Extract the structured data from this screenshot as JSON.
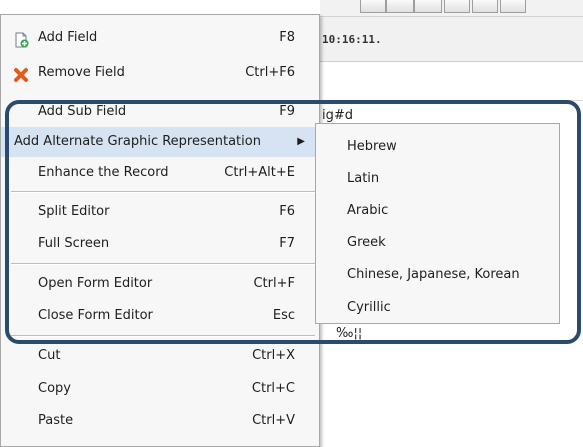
{
  "background": {
    "timestamp": "10:16:11.",
    "field_text": "ig#d",
    "bottom_text": "‰¦¦"
  },
  "menu": {
    "items": [
      {
        "name": "add-field",
        "label": "Add Field",
        "shortcut": "F8",
        "icon": "add-field-icon"
      },
      {
        "name": "remove-field",
        "label": "Remove Field",
        "shortcut": "Ctrl+F6",
        "icon": "remove-field-icon"
      },
      {
        "name": "add-sub-field",
        "label": "Add Sub Field",
        "shortcut": "F9"
      },
      {
        "name": "add-alternate-graphic-representation",
        "label": "Add Alternate Graphic Representation",
        "submenu_arrow": "▶",
        "highlighted": true
      },
      {
        "name": "enhance-the-record",
        "label": "Enhance the Record",
        "shortcut": "Ctrl+Alt+E"
      },
      {
        "name": "split-editor",
        "label": "Split Editor",
        "shortcut": "F6"
      },
      {
        "name": "full-screen",
        "label": "Full Screen",
        "shortcut": "F7"
      },
      {
        "name": "open-form-editor",
        "label": "Open Form Editor",
        "shortcut": "Ctrl+F"
      },
      {
        "name": "close-form-editor",
        "label": "Close Form Editor",
        "shortcut": "Esc"
      },
      {
        "name": "cut",
        "label": "Cut",
        "shortcut": "Ctrl+X"
      },
      {
        "name": "copy",
        "label": "Copy",
        "shortcut": "Ctrl+C"
      },
      {
        "name": "paste",
        "label": "Paste",
        "shortcut": "Ctrl+V"
      }
    ]
  },
  "submenu": {
    "items": [
      "Hebrew",
      "Latin",
      "Arabic",
      "Greek",
      "Chinese, Japanese, Korean",
      "Cyrillic"
    ]
  },
  "colors": {
    "highlight": "#d5e3f2",
    "callout_border": "#2c4a6b",
    "remove_icon": "#e25a1c",
    "add_icon": "#3aa14a"
  }
}
